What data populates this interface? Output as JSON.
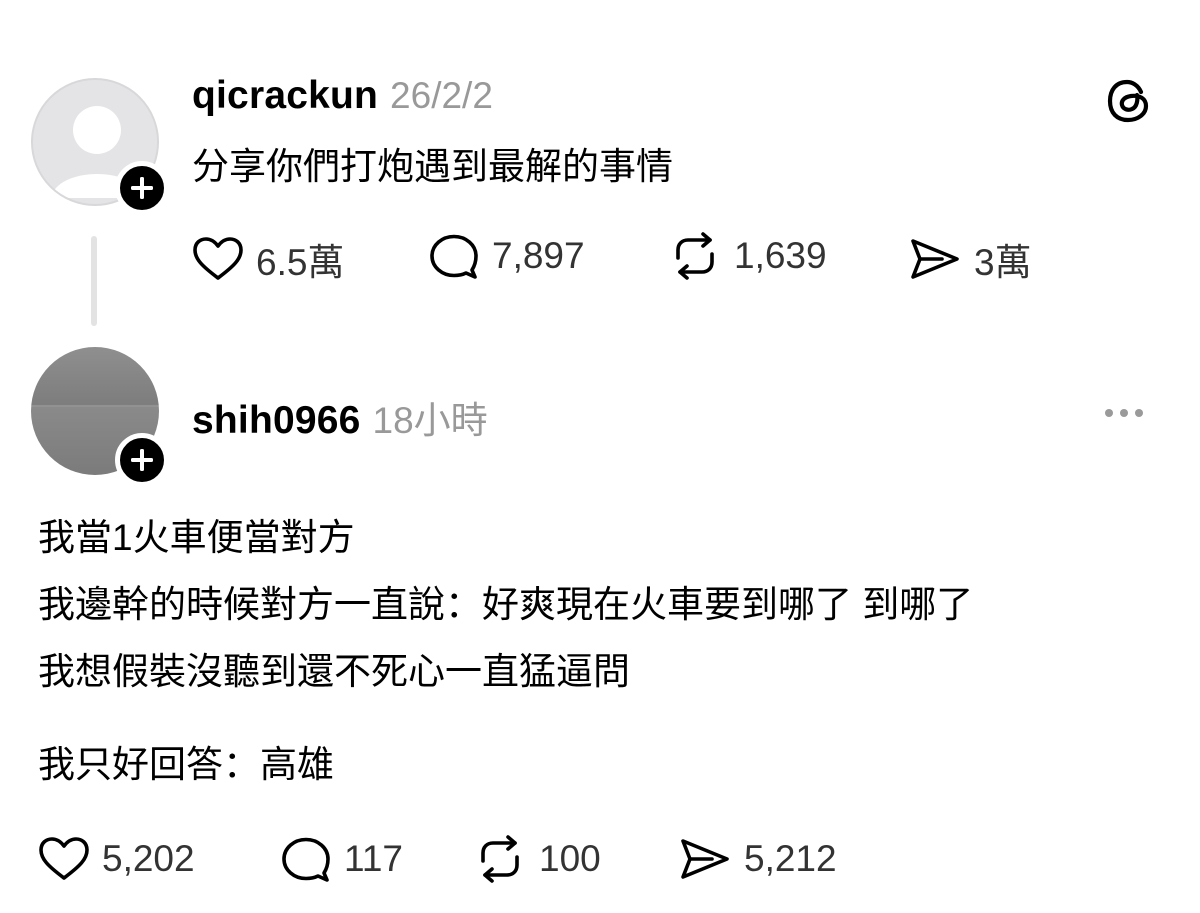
{
  "post1": {
    "username": "qicrackun",
    "time": "26/2/2",
    "text": "分享你們打炮遇到最解的事情",
    "likes": "6.5萬",
    "comments": "7,897",
    "reposts": "1,639",
    "shares": "3萬"
  },
  "post2": {
    "username": "shih0966",
    "time": "18小時",
    "lines": [
      "我當1火車便當對方",
      "我邊幹的時候對方一直說：好爽現在火車要到哪了 到哪了",
      "我想假裝沒聽到還不死心一直猛逼問",
      "我只好回答：高雄"
    ],
    "likes": "5,202",
    "comments": "117",
    "reposts": "100",
    "shares": "5,212"
  },
  "icons": {
    "brand": "threads-logo-icon",
    "follow": "plus-icon",
    "like": "heart-icon",
    "comment": "comment-bubble-icon",
    "repost": "repost-icon",
    "share": "share-send-icon",
    "more": "more-horizontal-icon"
  }
}
